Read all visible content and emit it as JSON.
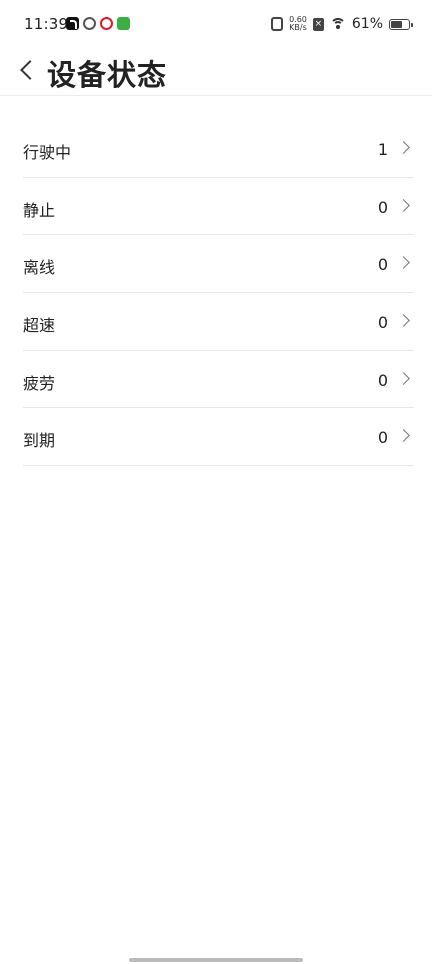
{
  "status_bar": {
    "time": "11:39",
    "net_speed_value": "0.60",
    "net_speed_unit": "KB/s",
    "battery_percent": "61%",
    "apps": [
      "tiktok-icon",
      "app2-icon",
      "weibo-icon",
      "green-app-icon"
    ]
  },
  "header": {
    "title": "设备状态"
  },
  "rows": [
    {
      "label": "行驶中",
      "value": "1"
    },
    {
      "label": "静止",
      "value": "0"
    },
    {
      "label": "离线",
      "value": "0"
    },
    {
      "label": "超速",
      "value": "0"
    },
    {
      "label": "疲劳",
      "value": "0"
    },
    {
      "label": "到期",
      "value": "0"
    }
  ]
}
